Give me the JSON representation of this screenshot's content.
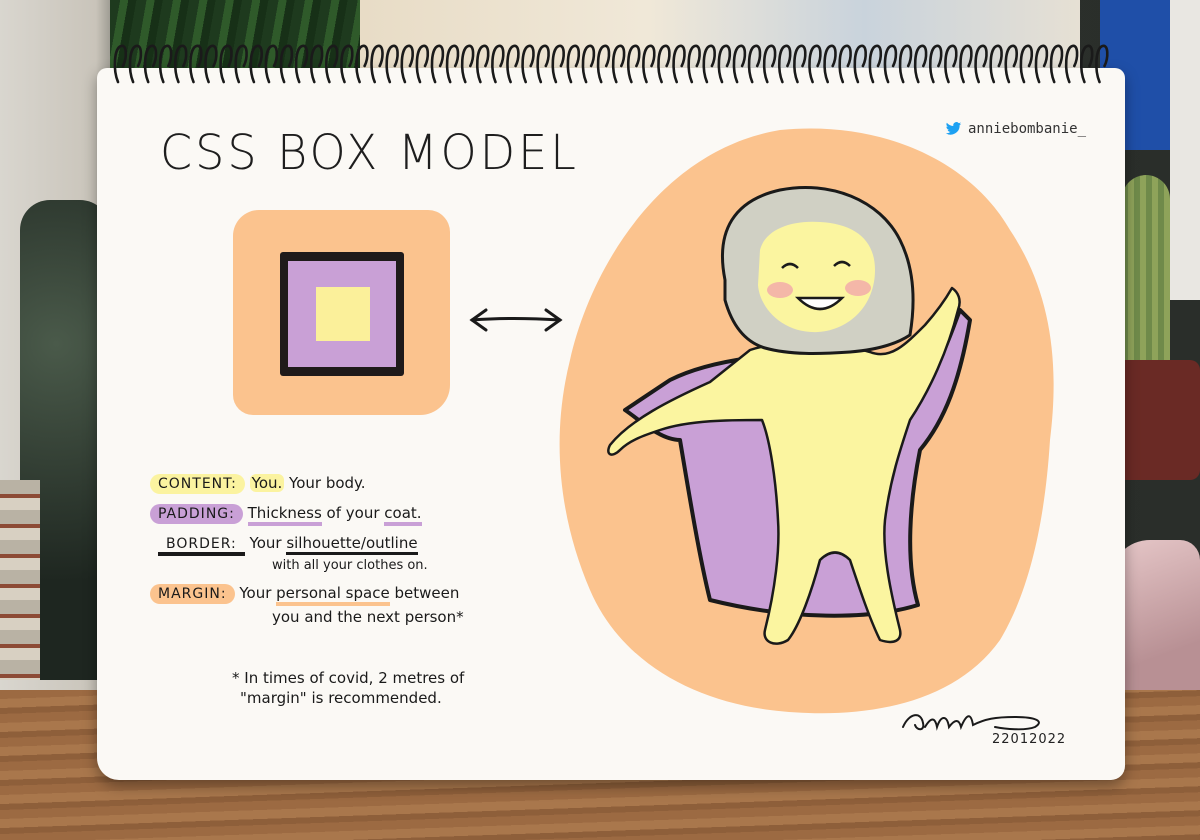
{
  "sketch": {
    "title": "CSS BOX MODEL",
    "handle": "anniebombanie_",
    "handle_icon": "twitter-bird-icon",
    "legend": {
      "content": {
        "tag": "CONTENT:",
        "text_hl": "You.",
        "text_rest": " Your body."
      },
      "padding": {
        "tag": "PADDING:",
        "u1": "Thickness",
        "mid": " of your ",
        "u2": "coat."
      },
      "border": {
        "tag": "BORDER:",
        "pre": "Your ",
        "u1": "silhouette/outline",
        "line2": "with all your clothes on."
      },
      "margin": {
        "tag": "MARGIN:",
        "pre": "Your ",
        "u1": "personal space",
        "post": " between",
        "line2": "you and the next person*"
      }
    },
    "footnote_line1": "* In times of covid, 2 metres of",
    "footnote_line2": "\"margin\" is recommended.",
    "date": "22012022"
  },
  "colors": {
    "margin": "#fbc38e",
    "padding": "#c9a0d6",
    "border": "#1f1a1a",
    "content": "#fbf09a",
    "paper": "#fbf9f5"
  }
}
